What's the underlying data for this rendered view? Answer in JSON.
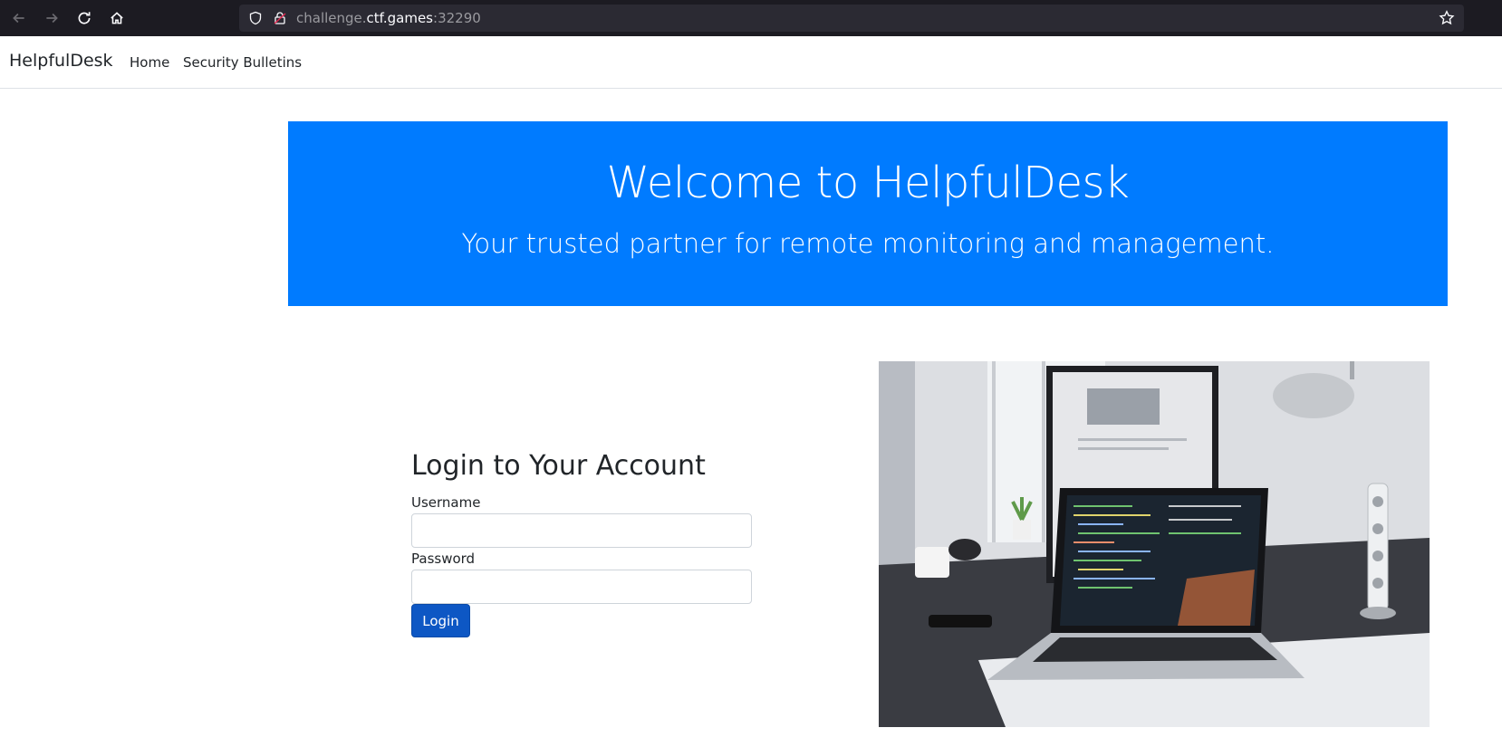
{
  "browser": {
    "url_prefix": "challenge.",
    "url_host": "ctf.games",
    "url_port": ":32290"
  },
  "navbar": {
    "brand": "HelpfulDesk",
    "links": [
      "Home",
      "Security Bulletins"
    ]
  },
  "hero": {
    "title": "Welcome to HelpfulDesk",
    "subtitle": "Your trusted partner for remote monitoring and management."
  },
  "login": {
    "title": "Login to Your Account",
    "username_label": "Username",
    "username_value": "",
    "password_label": "Password",
    "password_value": "",
    "button_label": "Login"
  },
  "colors": {
    "hero_bg": "#007bff",
    "button_bg": "#0d57c4",
    "chrome_bg": "#1c1b22"
  },
  "image": {
    "description_icon": "laptop-desk-photo"
  }
}
